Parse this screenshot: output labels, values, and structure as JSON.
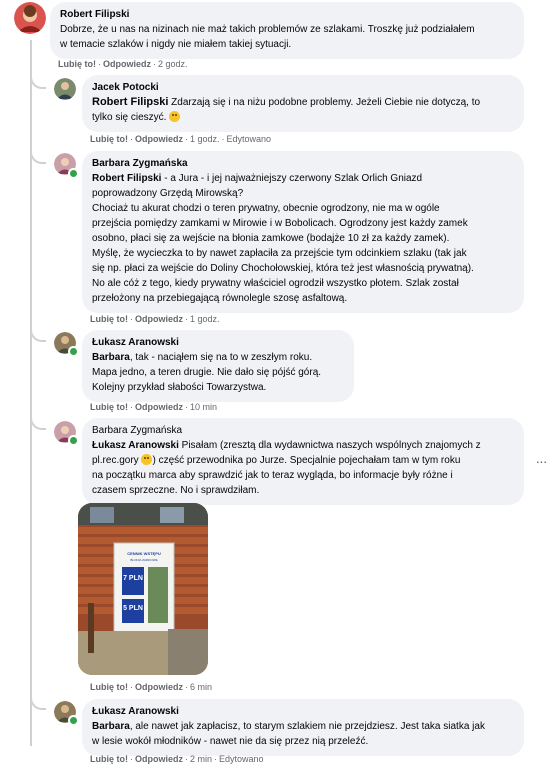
{
  "labels": {
    "like": "Lubię to!",
    "reply": "Odpowiedz",
    "dot": "·"
  },
  "colors": {
    "bubble": "#f0f2f5",
    "online": "#31a24c",
    "meta": "#65676b"
  },
  "comments": [
    {
      "author": "Robert Filipski",
      "lines": [
        "Dobrze, że u nas na nizinach nie maż takich problemów ze szlakami. Troszkę już podziałałem",
        "w temacie szlaków i nigdy nie miałem takiej sytuacji."
      ],
      "time": "2 godz."
    },
    {
      "author": "Jacek Potocki",
      "mention": "Robert Filipski",
      "lines": [
        " Zdarzają się i na niżu podobne problemy. Jeżeli Ciebie nie dotyczą, to",
        "tylko się cieszyć. "
      ],
      "time": "1 godz.",
      "edited": "Edytowano"
    },
    {
      "author": "Barbara Zygmańska",
      "mention": "Robert Filipski",
      "lines": [
        " - a Jura - i jej najważniejszy czerwony Szlak Orlich Gniazd",
        "poprowadzony Grzędą Mirowską?",
        "Chociaż tu akurat chodzi o teren prywatny, obecnie ogrodzony, nie ma w ogóle",
        "przejścia pomiędzy zamkami w Mirowie i w Bobolicach. Ogrodzony jest każdy zamek",
        "osobno, płaci się za wejście na błonia zamkowe (bodajże 10 zł za każdy zamek).",
        "Myślę, że wycieczka to by nawet zapłaciła za przejście tym odcinkiem szlaku (tak jak",
        "się np. płaci za wejście do Doliny Chochołowskiej, która też jest własnością prywatną).",
        "No ale cóż z tego, kiedy prywatny właściciel ogrodził wszystko płotem. Szlak został",
        "przełożony na przebiegającą równolegle szosę asfaltową."
      ],
      "time": "1 godz."
    },
    {
      "author": "Łukasz Aranowski",
      "mention": "Barbara",
      "lines": [
        ", tak - naciąłem się na to w zeszłym roku.",
        "Mapa jedno, a teren drugie. Nie dało się pójść górą.",
        "Kolejny przykład słabości Towarzystwa."
      ],
      "time": "10 min"
    },
    {
      "author": "Barbara Zygmańska",
      "mention": "Łukasz Aranowski",
      "lines": [
        " Pisałam (zresztą dla wydawnictwa naszych wspólnych znajomych z",
        "pl.rec.gory ",
        ") część przewodnika po Jurze. Specjalnie pojechałam tam w tym roku",
        "na początku marca aby sprawdzić jak to teraz wygląda, bo informacje były różne i",
        "czasem sprzeczne. No i sprawdziłam."
      ],
      "time": "6 min",
      "sign": {
        "title": "CENNIK WSTĘPU",
        "subtitle": "BŁONIA ZAMKOWE",
        "price1": "7 PLN",
        "price2": "5 PLN"
      }
    },
    {
      "author": "Łukasz Aranowski",
      "mention": "Barbara",
      "lines": [
        ", ale nawet jak zapłacisz, to starym szlakiem nie przejdziesz. Jest taka siatka jak",
        "w lesie wokół młodników - nawet nie da się przez nią przeleźć."
      ],
      "time": "2 min",
      "edited": "Edytowano"
    }
  ]
}
